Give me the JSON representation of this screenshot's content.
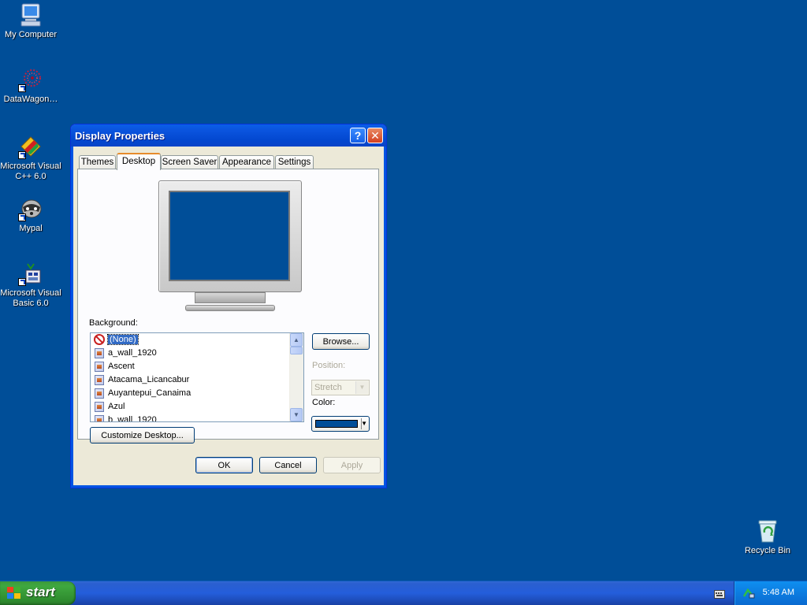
{
  "desktop": {
    "background_color": "#004e98",
    "icons": [
      {
        "label": "My Computer",
        "icon": "computer-icon"
      },
      {
        "label": "DataWagon…",
        "icon": "datawagon-icon"
      },
      {
        "label": "Microsoft Visual C++ 6.0",
        "icon": "visual-cpp-icon"
      },
      {
        "label": "Mypal",
        "icon": "mypal-icon"
      },
      {
        "label": "Microsoft Visual Basic 6.0",
        "icon": "visual-basic-icon"
      },
      {
        "label": "Recycle Bin",
        "icon": "recycle-bin-icon"
      }
    ]
  },
  "window": {
    "title": "Display Properties",
    "help_label": "?",
    "close_label": "✕",
    "tabs": [
      {
        "label": "Themes"
      },
      {
        "label": "Desktop"
      },
      {
        "label": "Screen Saver"
      },
      {
        "label": "Appearance"
      },
      {
        "label": "Settings"
      }
    ],
    "active_tab": "Desktop",
    "background_label": "Background:",
    "background_items": [
      {
        "label": "(None)",
        "selected": true
      },
      {
        "label": "a_wall_1920"
      },
      {
        "label": "Ascent"
      },
      {
        "label": "Atacama_Licancabur"
      },
      {
        "label": "Auyantepui_Canaima"
      },
      {
        "label": "Azul"
      },
      {
        "label": "b_wall_1920"
      }
    ],
    "browse_label": "Browse...",
    "position_label": "Position:",
    "position_value": "Stretch",
    "color_label": "Color:",
    "color_value": "#004e98",
    "customize_label": "Customize Desktop...",
    "ok_label": "OK",
    "cancel_label": "Cancel",
    "apply_label": "Apply"
  },
  "taskbar": {
    "start_label": "start",
    "clock": "5:48 AM"
  }
}
